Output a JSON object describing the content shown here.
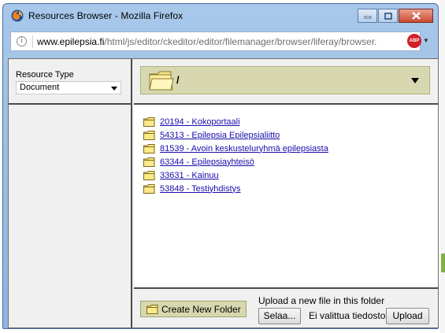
{
  "window": {
    "title": "Resources Browser - Mozilla Firefox"
  },
  "urlbar": {
    "domain": "www.epilepsia.fi",
    "path": "/html/js/editor/ckeditor/editor/filemanager/browser/liferay/browser.",
    "adblock_label": "ABP"
  },
  "sidebar": {
    "resource_type_label": "Resource Type",
    "resource_type_value": "Document"
  },
  "path": {
    "current": "/"
  },
  "folders": [
    {
      "label": "20194 - Kokoportaali"
    },
    {
      "label": "54313 - Epilepsia Epilepsialiitto"
    },
    {
      "label": "81539 - Avoin keskusteluryhmä epilepsiasta"
    },
    {
      "label": "63344 - Epilepsiayhteisö"
    },
    {
      "label": "33631 - Kainuu"
    },
    {
      "label": "53848 - Testiyhdistys"
    }
  ],
  "footer": {
    "create_folder_label": "Create New Folder",
    "upload_label": "Upload a new file in this folder",
    "browse_label": "Selaa...",
    "no_file_label": "Ei valittua tiedostoa.",
    "upload_button_label": "Upload"
  },
  "colors": {
    "title_gradient": "#a8c8ea",
    "path_bar": "#d8d8b0",
    "link": "#1a0dab",
    "close_button": "#c94a2e"
  },
  "icons": [
    "firefox-icon",
    "info-icon",
    "adblock-icon",
    "folder-icon"
  ]
}
